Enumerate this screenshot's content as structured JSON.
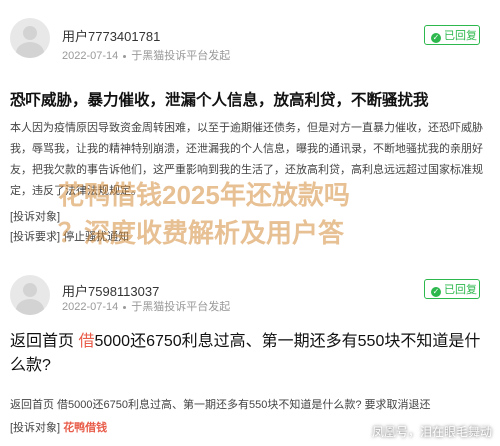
{
  "complaints": [
    {
      "user": "用户7773401781",
      "date": "2022-07-14",
      "source": "于黑猫投诉平台发起",
      "badge": "已回复",
      "title": "恐吓威胁，暴力催收，泄漏个人信息，放高利贷，不断骚扰我",
      "body": "本人因为疫情原因导致资金周转困难，以至于逾期催还债务，但是对方一直暴力催收，还恐吓威胁我，辱骂我，让我的精神特别崩溃，还泄漏我的个人信息，曝我的通讯录，不断地骚扰我的亲朋好友，把我欠款的事告诉他们，这严重影响到我的生活了，还放高利贷，高利息远远超过国家标准规定，违反了法律法规规定。",
      "field_object_label": "[投诉对象]",
      "field_request_label": "[投诉要求]",
      "field_request_value": "停止骚扰通知"
    },
    {
      "user": "用户7598113037",
      "date": "2022-07-14",
      "source": "于黑猫投诉平台发起",
      "badge": "已回复",
      "title_prefix": "返回首页 ",
      "title_highlight": "借",
      "title_rest": "5000还6750利息过高、第一期还多有550块不知道是什么款?",
      "body": "返回首页 借5000还6750利息过高、第一期还多有550块不知道是什么款? 要求取消退还",
      "field_object_label": "[投诉对象]",
      "field_object_value": "花鸭借钱"
    }
  ],
  "watermark": {
    "line1": "花鸭借钱2025年还放款吗",
    "line2": "？深度收费解析及用户答"
  },
  "credit": "凤凰号，泪在眼毛舞动",
  "colors": {
    "accent_green": "#2db84d",
    "highlight_red": "#e85d4a",
    "watermark": "#d48c3c"
  }
}
